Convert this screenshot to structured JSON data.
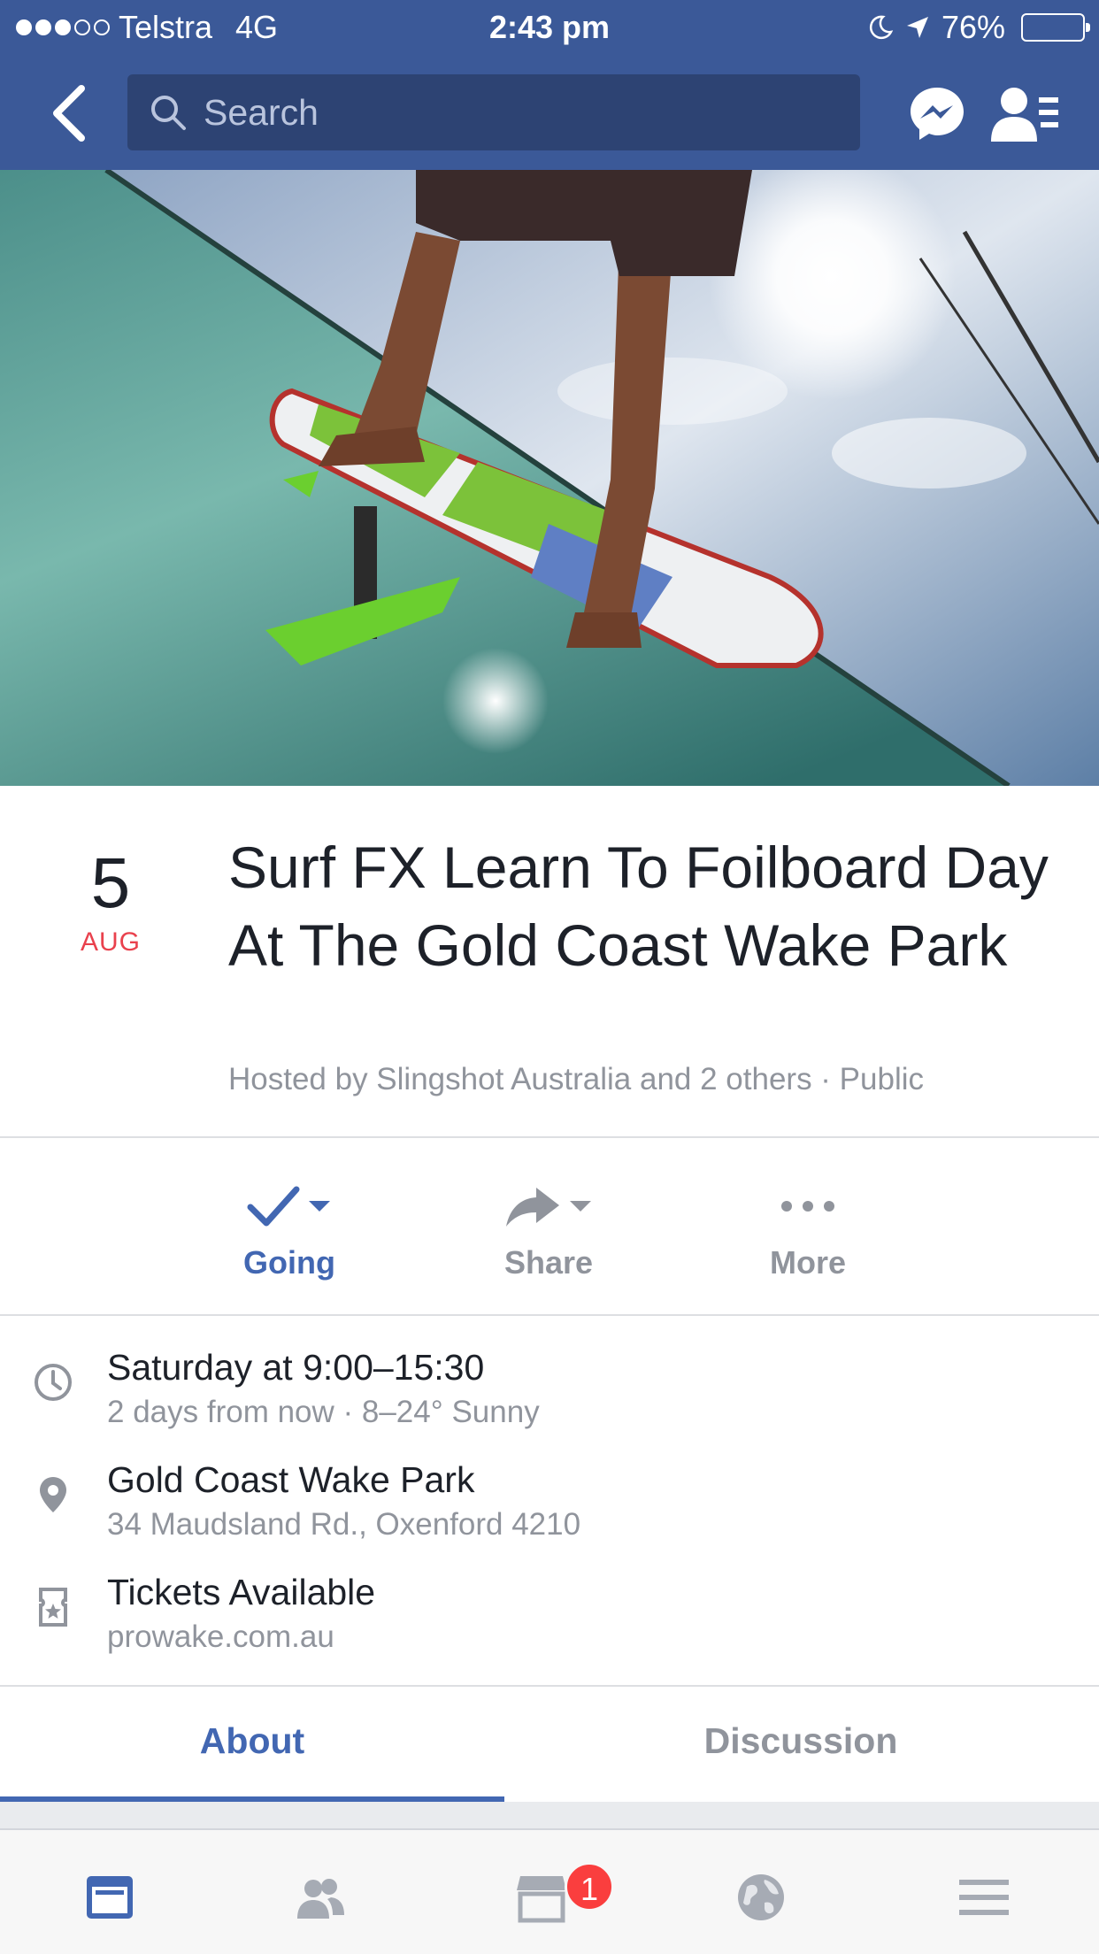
{
  "status_bar": {
    "carrier": "Telstra",
    "network": "4G",
    "time": "2:43 pm",
    "battery": "76%",
    "battery_level": 0.76,
    "signal_bars_filled": 3,
    "signal_bars_total": 5
  },
  "nav": {
    "search_placeholder": "Search",
    "icons": [
      "back-icon",
      "search-icon",
      "messenger-icon",
      "friend-requests-icon"
    ]
  },
  "event": {
    "date_day": "5",
    "date_month": "AUG",
    "title": "Surf FX Learn To Foilboard Day At The Gold Coast Wake Park",
    "host_line": "Hosted by Slingshot Australia and 2 others · Public"
  },
  "actions": {
    "going": "Going",
    "share": "Share",
    "more": "More"
  },
  "details": {
    "time_primary": "Saturday at 9:00–15:30",
    "time_secondary": "2 days from now · 8–24° Sunny",
    "location_primary": "Gold Coast Wake Park",
    "location_secondary": "34 Maudsland Rd., Oxenford 4210",
    "tickets_primary": "Tickets Available",
    "tickets_secondary": "prowake.com.au"
  },
  "tabs": {
    "about": "About",
    "discussion": "Discussion",
    "active": "about"
  },
  "tab_bar": {
    "items": [
      "news-feed",
      "friends",
      "marketplace",
      "notifications",
      "menu"
    ],
    "marketplace_badge": "1"
  },
  "colors": {
    "brand": "#3b5998",
    "accent": "#4267b2",
    "date_red": "#e9414d",
    "badge_red": "#fa3e3e",
    "secondary_text": "#90949c"
  }
}
